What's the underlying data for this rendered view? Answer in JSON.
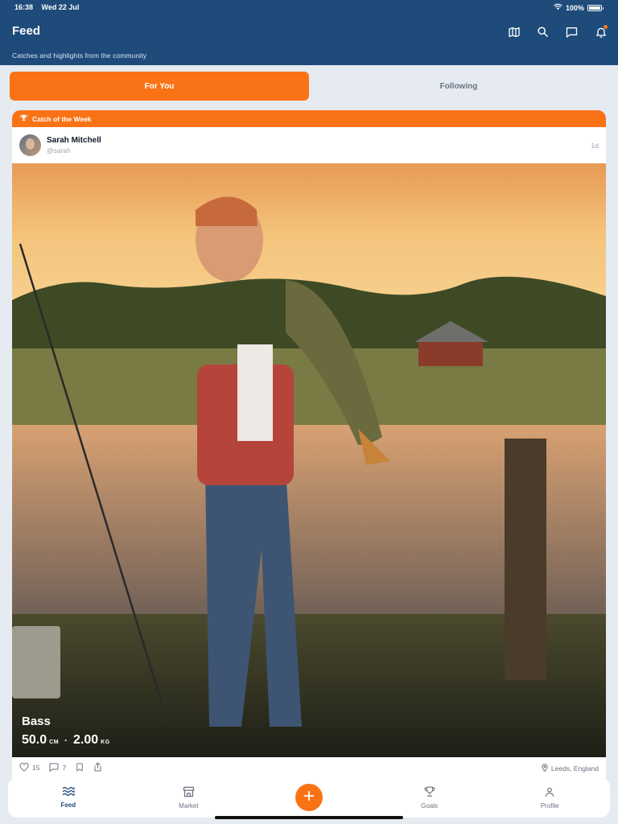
{
  "status_bar": {
    "time": "16:38",
    "date": "Wed 22 Jul",
    "battery": "100%",
    "battery_level": 1.0
  },
  "header": {
    "title": "Feed",
    "subtitle": "Catches and highlights from the community",
    "icons": [
      "map-icon",
      "search-icon",
      "chat-icon",
      "bell-icon"
    ]
  },
  "tabs": [
    {
      "label": "For You",
      "active": true
    },
    {
      "label": "Following",
      "active": false
    }
  ],
  "post": {
    "badge": "Catch of the Week",
    "user": {
      "name": "Sarah Mitchell",
      "handle": "@sarah"
    },
    "time": "1d",
    "catch": {
      "species": "Bass",
      "length": "50.0",
      "length_unit": "CM",
      "separator": "·",
      "weight": "2.00",
      "weight_unit": "KG"
    },
    "likes": "15",
    "comments": "7",
    "location": "Leeds, England"
  },
  "bottom_nav": {
    "items": [
      {
        "label": "Feed",
        "icon": "waves-icon",
        "active": true
      },
      {
        "label": "Market",
        "icon": "store-icon",
        "active": false
      },
      {
        "label": "Goals",
        "icon": "trophy-icon",
        "active": false
      },
      {
        "label": "Profile",
        "icon": "person-icon",
        "active": false
      }
    ],
    "fab_icon": "plus-icon"
  },
  "colors": {
    "header": "#1e4b7a",
    "accent": "#f97316",
    "background": "#e6ebf2"
  }
}
